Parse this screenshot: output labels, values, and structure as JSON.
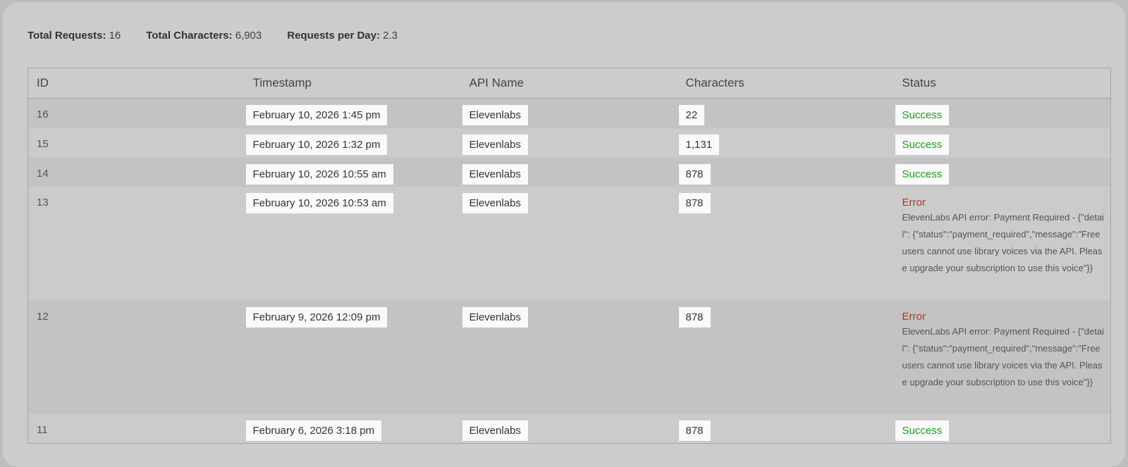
{
  "summary": {
    "total_requests_label": "Total Requests:",
    "total_requests": "16",
    "total_characters_label": "Total Characters:",
    "total_characters": "6,903",
    "requests_per_day_label": "Requests per Day:",
    "requests_per_day": "2.3"
  },
  "table": {
    "headers": [
      "ID",
      "Timestamp",
      "API Name",
      "Characters",
      "Status"
    ],
    "rows": [
      {
        "id": "16",
        "timestamp": "February 10, 2026 1:45 pm",
        "api": "Elevenlabs",
        "chars": "22",
        "status": "Success",
        "error": ""
      },
      {
        "id": "15",
        "timestamp": "February 10, 2026 1:32 pm",
        "api": "Elevenlabs",
        "chars": "1,131",
        "status": "Success",
        "error": ""
      },
      {
        "id": "14",
        "timestamp": "February 10, 2026 10:55 am",
        "api": "Elevenlabs",
        "chars": "878",
        "status": "Success",
        "error": ""
      },
      {
        "id": "13",
        "timestamp": "February 10, 2026 10:53 am",
        "api": "Elevenlabs",
        "chars": "878",
        "status": "Error",
        "error": "ElevenLabs API error: Payment Required - {\"detail\": {\"status\":\"payment_required\",\"message\":\"Free users cannot use library voices via the API. Please upgrade your subscription to use this voice\"}}"
      },
      {
        "id": "12",
        "timestamp": "February 9, 2026 12:09 pm",
        "api": "Elevenlabs",
        "chars": "878",
        "status": "Error",
        "error": "ElevenLabs API error: Payment Required - {\"detail\": {\"status\":\"payment_required\",\"message\":\"Free users cannot use library voices via the API. Please upgrade your subscription to use this voice\"}}"
      },
      {
        "id": "11",
        "timestamp": "February 6, 2026 3:18 pm",
        "api": "Elevenlabs",
        "chars": "878",
        "status": "Success",
        "error": ""
      }
    ]
  },
  "colors": {
    "success": "#1a9a1a",
    "error": "#b03a2e",
    "panel": "#cccccc"
  }
}
